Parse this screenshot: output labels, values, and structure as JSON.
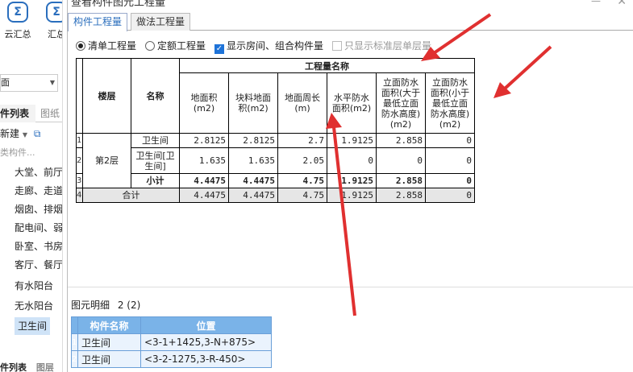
{
  "left_panel": {
    "toolbar": [
      {
        "icon": "cloud-summary-icon",
        "glyph": "Σ",
        "label": "云汇总"
      },
      {
        "icon": "summary-icon",
        "glyph": "Σ",
        "label": "汇总"
      }
    ],
    "combo_value": "面",
    "tabs": [
      "件列表",
      "图纸"
    ],
    "new_label": "新建",
    "search_placeholder": "类构件...",
    "items": [
      "大堂、前厅",
      "走廊、走道",
      "烟囱、排烟",
      "配电间、弱",
      "卧室、书房",
      "客厅、餐厅",
      "有水阳台",
      "无水阳台",
      "卫生间"
    ],
    "selected_item": "卫生间",
    "bottom_tabs": [
      "件列表",
      "图层"
    ]
  },
  "dialog": {
    "title": "查看构件图元工程量",
    "tabs": [
      "构件工程量",
      "做法工程量"
    ],
    "options": {
      "list_qty": "清单工程量",
      "quota_qty": "定额工程量",
      "show_room": "显示房间、组合构件量",
      "std_floor_only": "只显示标准层单层量"
    },
    "table": {
      "group_header": "工程量名称",
      "col_floor": "楼层",
      "col_name": "名称",
      "cols": [
        "地面积(m2)",
        "块料地面积(m2)",
        "地面周长(m)",
        "水平防水面积(m2)",
        "立面防水面积(大于最低立面防水高度)(m2)",
        "立面防水面积(小于最低立面防水高度)(m2)"
      ],
      "floor": "第2层",
      "rows": [
        {
          "no": "1",
          "name": "卫生间",
          "v": [
            "2.8125",
            "2.8125",
            "2.7",
            "1.9125",
            "2.858",
            "0"
          ]
        },
        {
          "no": "2",
          "name": "卫生间[卫生间]",
          "v": [
            "1.635",
            "1.635",
            "2.05",
            "0",
            "0",
            "0"
          ]
        },
        {
          "no": "3",
          "name": "小计",
          "v": [
            "4.4475",
            "4.4475",
            "4.75",
            "1.9125",
            "2.858",
            "0"
          ]
        }
      ],
      "total": {
        "no": "4",
        "name": "合计",
        "v": [
          "4.4475",
          "4.4475",
          "4.75",
          "1.9125",
          "2.858",
          "0"
        ]
      }
    },
    "detail": {
      "label": "图元明细",
      "count": "2 (2)",
      "headers": [
        "构件名称",
        "位置"
      ],
      "rows": [
        {
          "no": "1",
          "name": "卫生间",
          "pos": "<3-1+1425,3-N+875>"
        },
        {
          "no": "2",
          "name": "卫生间",
          "pos": "<3-2-1275,3-R-450>"
        }
      ]
    }
  }
}
